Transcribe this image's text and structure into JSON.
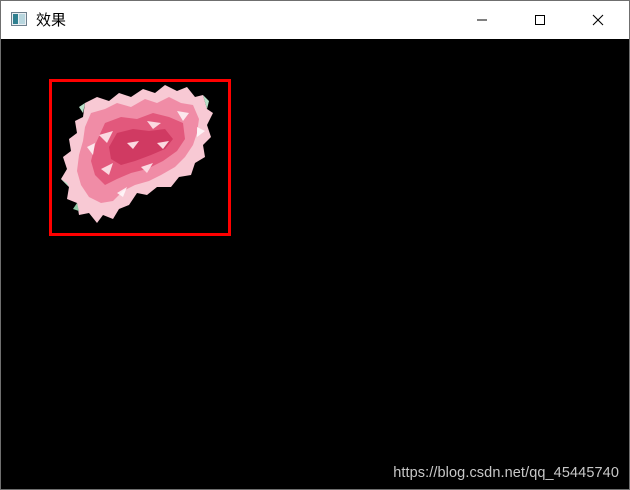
{
  "window": {
    "title": "效果",
    "controls": {
      "minimize_icon": "minimize-icon",
      "maximize_icon": "maximize-icon",
      "close_icon": "close-icon"
    }
  },
  "canvas": {
    "background": "#000000",
    "box_color": "#ff0000"
  },
  "watermark": "https://blog.csdn.net/qq_45445740"
}
